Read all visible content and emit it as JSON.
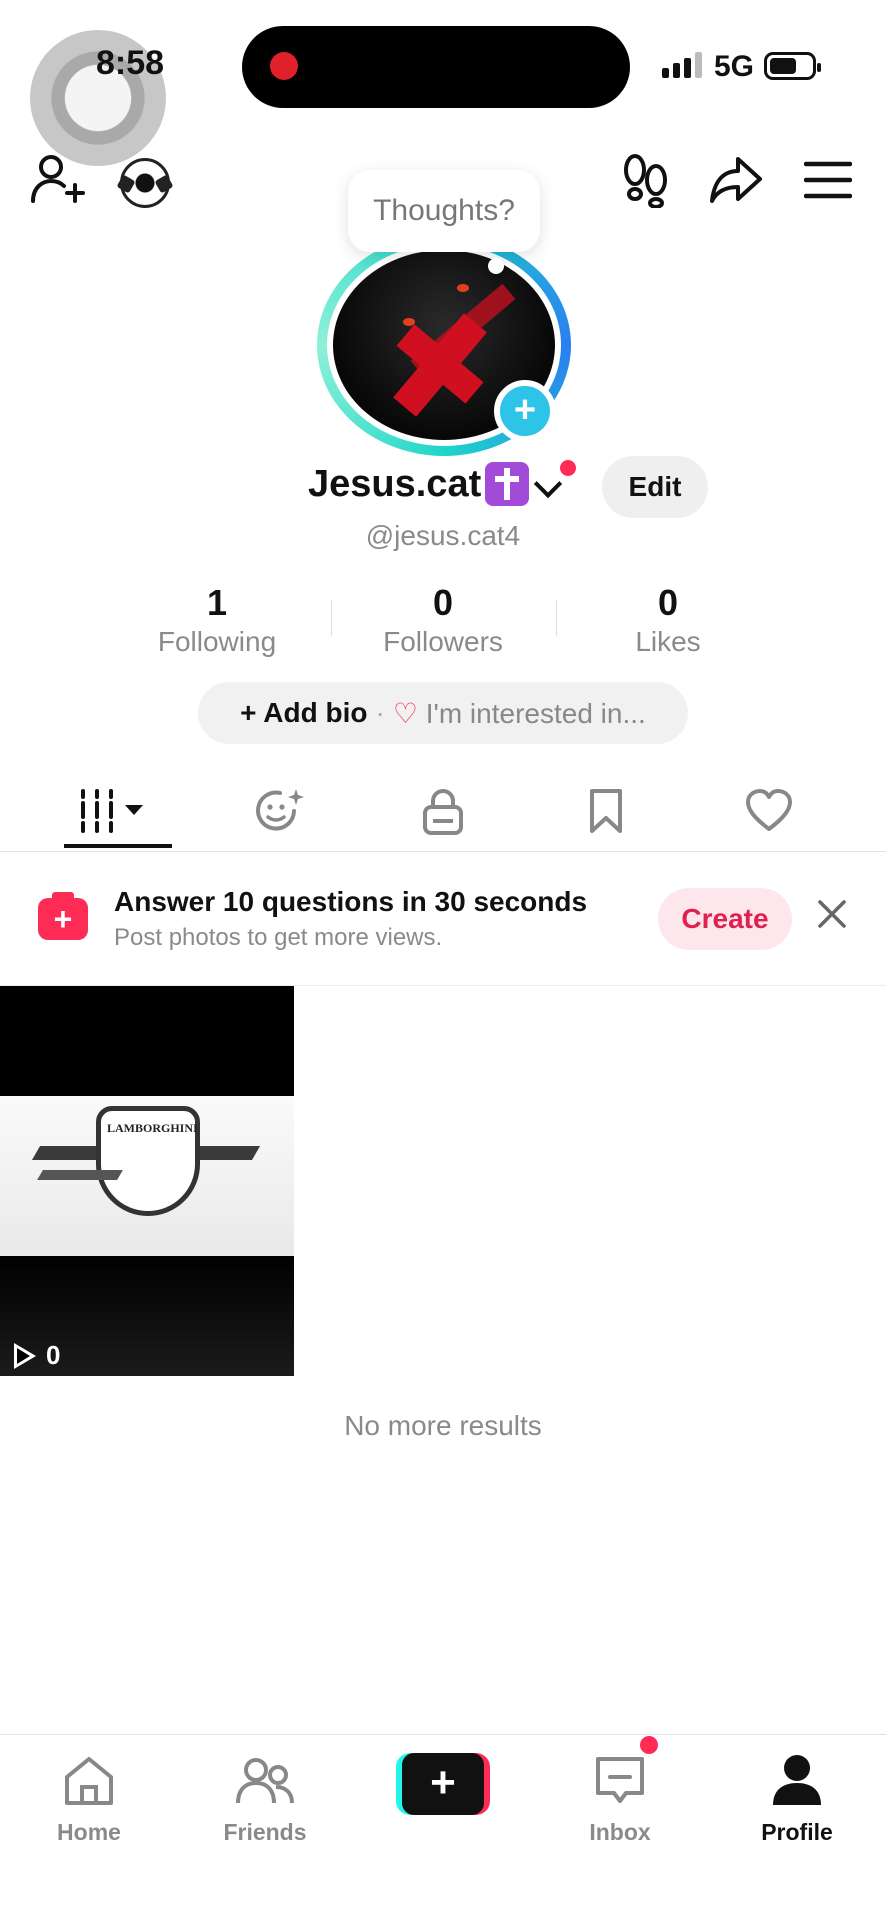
{
  "status_bar": {
    "time": "8:58",
    "network": "5G"
  },
  "profile": {
    "bubble_text": "Thoughts?",
    "display_name": "Jesus.cat",
    "handle": "@jesus.cat4",
    "edit_label": "Edit"
  },
  "stats": [
    {
      "value": "1",
      "label": "Following"
    },
    {
      "value": "0",
      "label": "Followers"
    },
    {
      "value": "0",
      "label": "Likes"
    }
  ],
  "bio": {
    "add_label": "Add bio",
    "separator": "·",
    "interest_label": "I'm interested in..."
  },
  "tabs": [
    {
      "icon": "grid-icon"
    },
    {
      "icon": "face-sparkle-icon"
    },
    {
      "icon": "lock-icon"
    },
    {
      "icon": "bookmark-icon"
    },
    {
      "icon": "heart-icon"
    }
  ],
  "promo": {
    "title": "Answer 10 questions in 30 seconds",
    "subtitle": "Post photos to get more views.",
    "create_label": "Create"
  },
  "video": {
    "logo_text": "LAMBORGHINI",
    "view_count": "0"
  },
  "no_more": "No more results",
  "nav": {
    "home": "Home",
    "friends": "Friends",
    "inbox": "Inbox",
    "profile": "Profile"
  },
  "colors": {
    "accent": "#fe2c55",
    "teal": "#25f4ee",
    "avatar_add": "#2ec4e8"
  }
}
